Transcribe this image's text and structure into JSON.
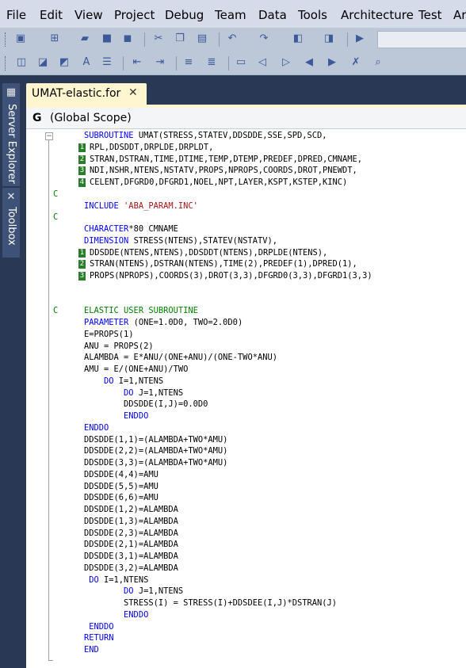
{
  "menu": [
    "File",
    "Edit",
    "View",
    "Project",
    "Debug",
    "Team",
    "Data",
    "Tools",
    "Architecture",
    "Test",
    "Ar"
  ],
  "toolbar1": {
    "icons": [
      "new-project-icon",
      "add-item-icon",
      "open-file-icon",
      "save-icon",
      "save-all-icon",
      "cut-icon",
      "copy-icon",
      "paste-icon",
      "undo-icon",
      "redo-icon",
      "navigate-backward-icon",
      "navigate-forward-icon",
      "start-debugging-icon"
    ],
    "config_value": ""
  },
  "toolbar2": {
    "icons": [
      "quick-info-icon",
      "parameter-info-icon",
      "word-completion-icon",
      "display-word-icon",
      "list-members-icon",
      "decrease-indent-icon",
      "increase-indent-icon",
      "comment-icon",
      "uncomment-icon",
      "toggle-bookmark-icon",
      "previous-bookmark-icon",
      "next-bookmark-icon",
      "previous-bookmark-folder-icon",
      "next-bookmark-folder-icon",
      "clear-bookmarks-icon",
      "find-in-files-icon"
    ]
  },
  "side_panel": {
    "server_explorer": "Server Explorer",
    "toolbox": "Toolbox"
  },
  "document_tab": {
    "title": "UMAT-elastic.for",
    "close": "✕"
  },
  "scope": {
    "icon": "G",
    "label": "(Global Scope)"
  },
  "colors": {
    "keyword": "#0000ff",
    "string": "#a31515",
    "comment": "#008000",
    "text": "#000000"
  },
  "code": [
    {
      "c": "",
      "box": "",
      "text": "SUBROUTINE UMAT(STRESS,STATEV,DDSDDE,SSE,SPD,SCD,",
      "kw": "SUBROUTINE",
      "rest": " UMAT(STRESS,STATEV,DDSDDE,SSE,SPD,SCD,"
    },
    {
      "c": "",
      "box": "1",
      "text": "RPL,DDSDDT,DRPLDE,DRPLDT,"
    },
    {
      "c": "",
      "box": "2",
      "text": "STRAN,DSTRAN,TIME,DTIME,TEMP,DTEMP,PREDEF,DPRED,CMNAME,"
    },
    {
      "c": "",
      "box": "3",
      "text": "NDI,NSHR,NTENS,NSTATV,PROPS,NPROPS,COORDS,DROT,PNEWDT,"
    },
    {
      "c": "",
      "box": "4",
      "text": "CELENT,DFGRD0,DFGRD1,NOEL,NPT,LAYER,KSPT,KSTEP,KINC)"
    },
    {
      "c": "C",
      "box": "",
      "text": ""
    },
    {
      "c": "",
      "box": "",
      "text": "INCLUDE 'ABA_PARAM.INC'",
      "kw": "INCLUDE",
      "str": " 'ABA_PARAM.INC'"
    },
    {
      "c": "C",
      "box": "",
      "text": ""
    },
    {
      "c": "",
      "box": "",
      "text": "CHARACTER*80 CMNAME",
      "kw": "CHARACTER",
      "rest": "*80 CMNAME"
    },
    {
      "c": "",
      "box": "",
      "text": "DIMENSION STRESS(NTENS),STATEV(NSTATV),",
      "kw": "DIMENSION",
      "rest": " STRESS(NTENS),STATEV(NSTATV),"
    },
    {
      "c": "",
      "box": "1",
      "text": "DDSDDE(NTENS,NTENS),DDSDDT(NTENS),DRPLDE(NTENS),"
    },
    {
      "c": "",
      "box": "2",
      "text": "STRAN(NTENS),DSTRAN(NTENS),TIME(2),PREDEF(1),DPRED(1),"
    },
    {
      "c": "",
      "box": "3",
      "text": "PROPS(NPROPS),COORDS(3),DROT(3,3),DFGRD0(3,3),DFGRD1(3,3)"
    },
    {
      "c": "",
      "box": "",
      "text": ""
    },
    {
      "c": "",
      "box": "",
      "text": ""
    },
    {
      "c": "C",
      "box": "",
      "text": "ELASTIC USER SUBROUTINE",
      "comment": true
    },
    {
      "c": "",
      "box": "",
      "text": "PARAMETER (ONE=1.0D0, TWO=2.0D0)",
      "kw": "PARAMETER",
      "rest": " (ONE=1.0D0, TWO=2.0D0)"
    },
    {
      "c": "",
      "box": "",
      "text": "E=PROPS(1)"
    },
    {
      "c": "",
      "box": "",
      "text": "ANU = PROPS(2)"
    },
    {
      "c": "",
      "box": "",
      "text": "ALAMBDA = E*ANU/(ONE+ANU)/(ONE-TWO*ANU)"
    },
    {
      "c": "",
      "box": "",
      "text": "AMU = E/(ONE+ANU)/TWO"
    },
    {
      "c": "",
      "box": "",
      "text": "    DO I=1,NTENS",
      "kw": "    DO",
      "rest": " I=1,NTENS"
    },
    {
      "c": "",
      "box": "",
      "text": "        DO J=1,NTENS",
      "kw": "        DO",
      "rest": " J=1,NTENS"
    },
    {
      "c": "",
      "box": "",
      "text": "        DDSDDE(I,J)=0.0D0"
    },
    {
      "c": "",
      "box": "",
      "text": "        ENDDO",
      "kw": "        ENDDO",
      "rest": ""
    },
    {
      "c": "",
      "box": "",
      "text": "ENDDO",
      "kw": "ENDDO",
      "rest": ""
    },
    {
      "c": "",
      "box": "",
      "text": "DDSDDE(1,1)=(ALAMBDA+TWO*AMU)"
    },
    {
      "c": "",
      "box": "",
      "text": "DDSDDE(2,2)=(ALAMBDA+TWO*AMU)"
    },
    {
      "c": "",
      "box": "",
      "text": "DDSDDE(3,3)=(ALAMBDA+TWO*AMU)"
    },
    {
      "c": "",
      "box": "",
      "text": "DDSDDE(4,4)=AMU"
    },
    {
      "c": "",
      "box": "",
      "text": "DDSDDE(5,5)=AMU"
    },
    {
      "c": "",
      "box": "",
      "text": "DDSDDE(6,6)=AMU"
    },
    {
      "c": "",
      "box": "",
      "text": "DDSDDE(1,2)=ALAMBDA"
    },
    {
      "c": "",
      "box": "",
      "text": "DDSDDE(1,3)=ALAMBDA"
    },
    {
      "c": "",
      "box": "",
      "text": "DDSDDE(2,3)=ALAMBDA"
    },
    {
      "c": "",
      "box": "",
      "text": "DDSDDE(2,1)=ALAMBDA"
    },
    {
      "c": "",
      "box": "",
      "text": "DDSDDE(3,1)=ALAMBDA"
    },
    {
      "c": "",
      "box": "",
      "text": "DDSDDE(3,2)=ALAMBDA"
    },
    {
      "c": "",
      "box": "",
      "text": " DO I=1,NTENS",
      "kw": " DO",
      "rest": " I=1,NTENS"
    },
    {
      "c": "",
      "box": "",
      "text": "        DO J=1,NTENS",
      "kw": "        DO",
      "rest": " J=1,NTENS"
    },
    {
      "c": "",
      "box": "",
      "text": "        STRESS(I) = STRESS(I)+DDSDEE(I,J)*DSTRAN(J)"
    },
    {
      "c": "",
      "box": "",
      "text": "        ENDDO",
      "kw": "        ENDDO",
      "rest": ""
    },
    {
      "c": "",
      "box": "",
      "text": " ENDDO",
      "kw": " ENDDO",
      "rest": ""
    },
    {
      "c": "",
      "box": "",
      "text": "RETURN",
      "kw": "RETURN",
      "rest": ""
    },
    {
      "c": "",
      "box": "",
      "text": "END",
      "kw": "END",
      "rest": ""
    }
  ]
}
